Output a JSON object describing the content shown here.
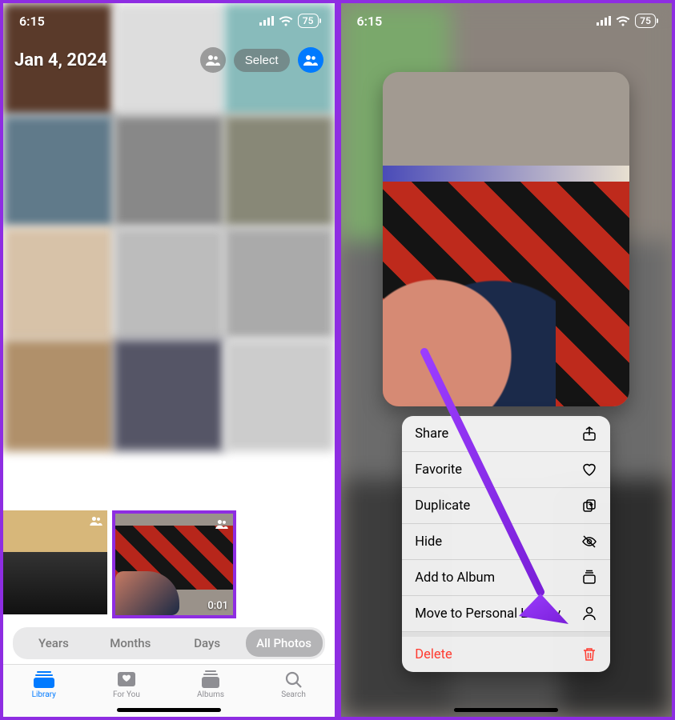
{
  "status": {
    "time": "6:15",
    "battery": "75"
  },
  "left": {
    "date_title": "Jan 4, 2024",
    "select_label": "Select",
    "thumb_duration": "0:01",
    "view_tabs": {
      "years": "Years",
      "months": "Months",
      "days": "Days",
      "all_photos": "All Photos"
    },
    "tab_bar": {
      "library": "Library",
      "for_you": "For You",
      "albums": "Albums",
      "search": "Search"
    }
  },
  "right": {
    "menu": {
      "share": "Share",
      "favorite": "Favorite",
      "duplicate": "Duplicate",
      "hide": "Hide",
      "add_to_album": "Add to Album",
      "move_personal": "Move to Personal Library",
      "delete": "Delete"
    }
  }
}
